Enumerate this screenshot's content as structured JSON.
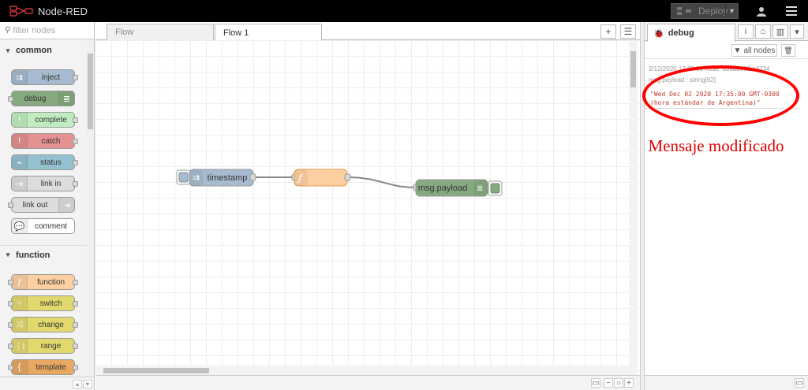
{
  "app": {
    "title": "Node-RED"
  },
  "header": {
    "deploy_label": "Deploy"
  },
  "palette": {
    "search_placeholder": "filter nodes",
    "categories": [
      {
        "name": "common",
        "nodes": [
          "inject",
          "debug",
          "complete",
          "catch",
          "status",
          "link in",
          "link out",
          "comment"
        ]
      },
      {
        "name": "function",
        "nodes": [
          "function",
          "switch",
          "change",
          "range",
          "template"
        ]
      }
    ]
  },
  "workspace": {
    "tabs": [
      {
        "label": "Flow"
      },
      {
        "label": "Flow 1"
      }
    ],
    "active_tab": "Flow 1",
    "flow_nodes": [
      {
        "label": "timestamp",
        "type": "inject",
        "color": "#a6bbcf"
      },
      {
        "label": "",
        "type": "function",
        "color": "#fdd0a2"
      },
      {
        "label": "msg.payload",
        "type": "debug",
        "color": "#87a980"
      }
    ]
  },
  "sidebar": {
    "active_tab": "debug",
    "filter_label": "all nodes",
    "message": {
      "meta": "2/12/2020 17:35:00   node: db9dbe82.a3734",
      "type": "msg.payload : string[62]",
      "value": "\"Wed Dec 02 2020 17:35:00 GMT-0300 (hora estándar de Argentina)\""
    }
  },
  "annotation": {
    "text": "Mensaje modificado",
    "color": "#e00000"
  }
}
